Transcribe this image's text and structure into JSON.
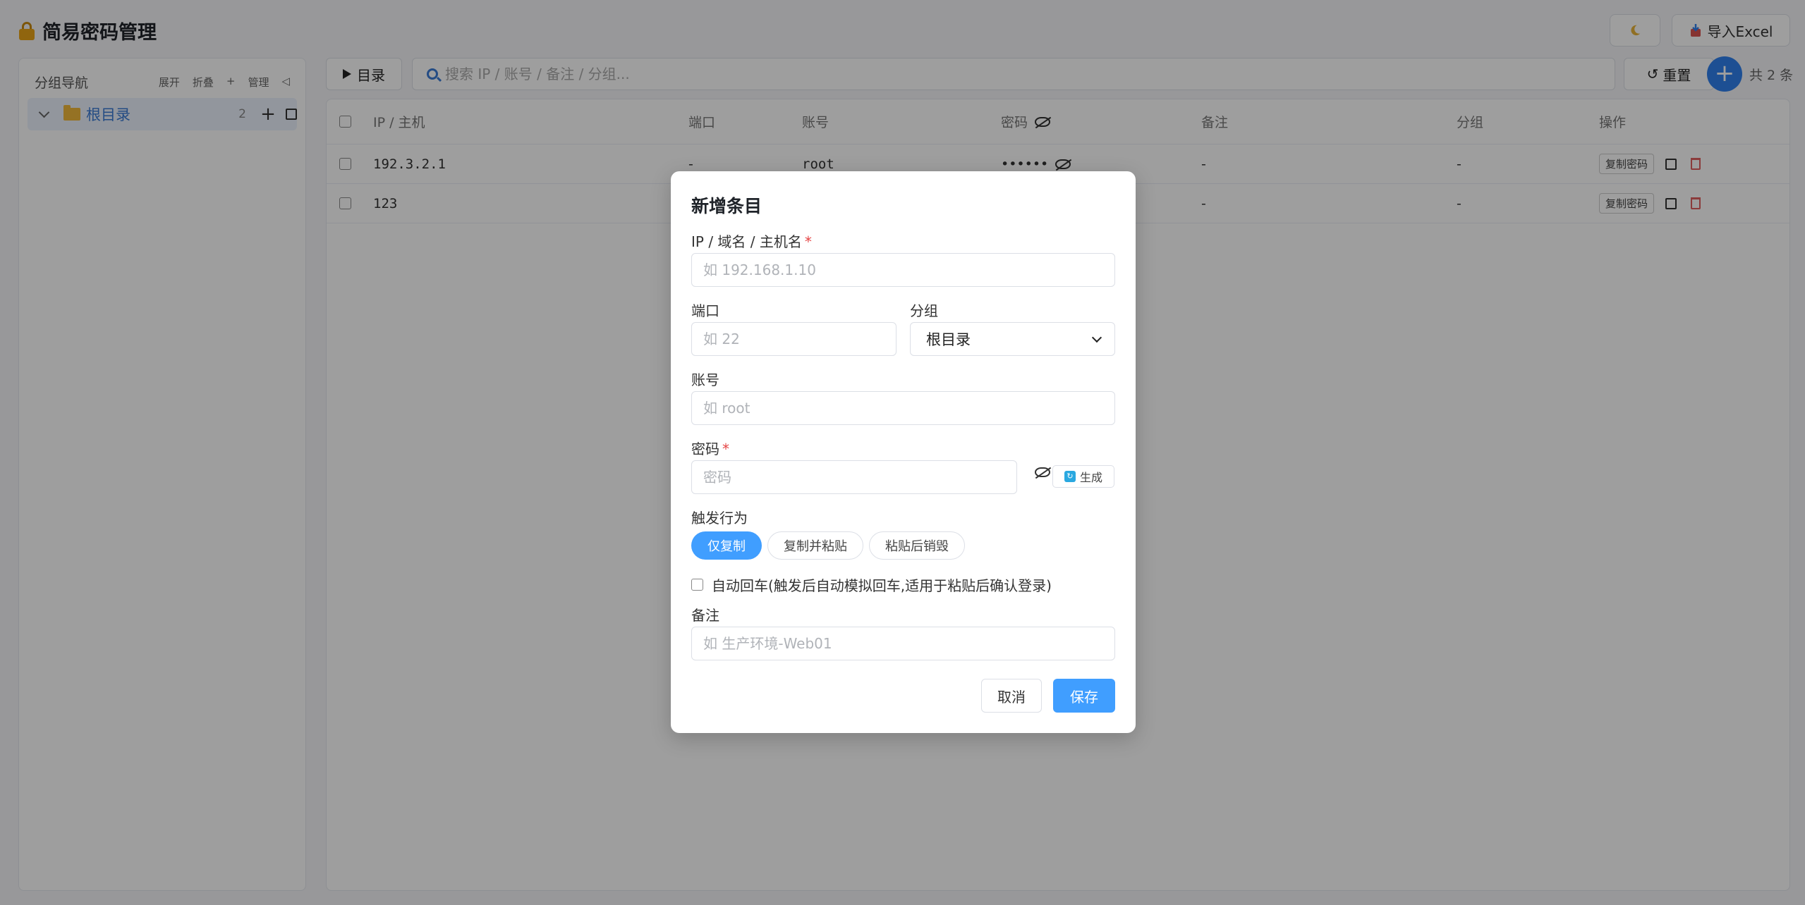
{
  "app": {
    "title": "简易密码管理"
  },
  "header": {
    "theme_icon": "moon-icon",
    "import_label": "导入Excel"
  },
  "sidebar": {
    "title": "分组导航",
    "actions": [
      "展开",
      "折叠",
      "+",
      "管理",
      "◁"
    ],
    "tree": [
      {
        "label": "根目录",
        "count": "2"
      }
    ]
  },
  "toolbar": {
    "dir_label": "目录",
    "search_placeholder": "搜索 IP / 账号 / 备注 / 分组...",
    "reset_label": "重置",
    "add_label": "+",
    "total": "共 2 条"
  },
  "table": {
    "columns": [
      "IP / 主机",
      "端口",
      "账号",
      "密码",
      "备注",
      "分组",
      "操作"
    ],
    "rows": [
      {
        "ip": "192.3.2.1",
        "port": "-",
        "account": "root",
        "password": "••••••",
        "note": "-",
        "group": "-",
        "copy_label": "复制密码"
      },
      {
        "ip": "123",
        "port": "",
        "account": "",
        "password": "",
        "note": "-",
        "group": "-",
        "copy_label": "复制密码"
      }
    ]
  },
  "modal": {
    "title": "新增条目",
    "ip_label": "IP / 域名 / 主机名",
    "ip_placeholder": "如 192.168.1.10",
    "port_label": "端口",
    "port_placeholder": "如 22",
    "group_label": "分组",
    "group_value": "根目录",
    "account_label": "账号",
    "account_placeholder": "如 root",
    "password_label": "密码",
    "password_placeholder": "密码",
    "generate_label": "生成",
    "trigger_label": "触发行为",
    "trigger_options": [
      "仅复制",
      "复制并粘贴",
      "粘贴后销毁"
    ],
    "auto_enter_label": "自动回车(触发后自动模拟回车,适用于粘贴后确认登录)",
    "note_label": "备注",
    "note_placeholder": "如 生产环境-Web01",
    "cancel_label": "取消",
    "save_label": "保存",
    "required_mark": "*"
  }
}
